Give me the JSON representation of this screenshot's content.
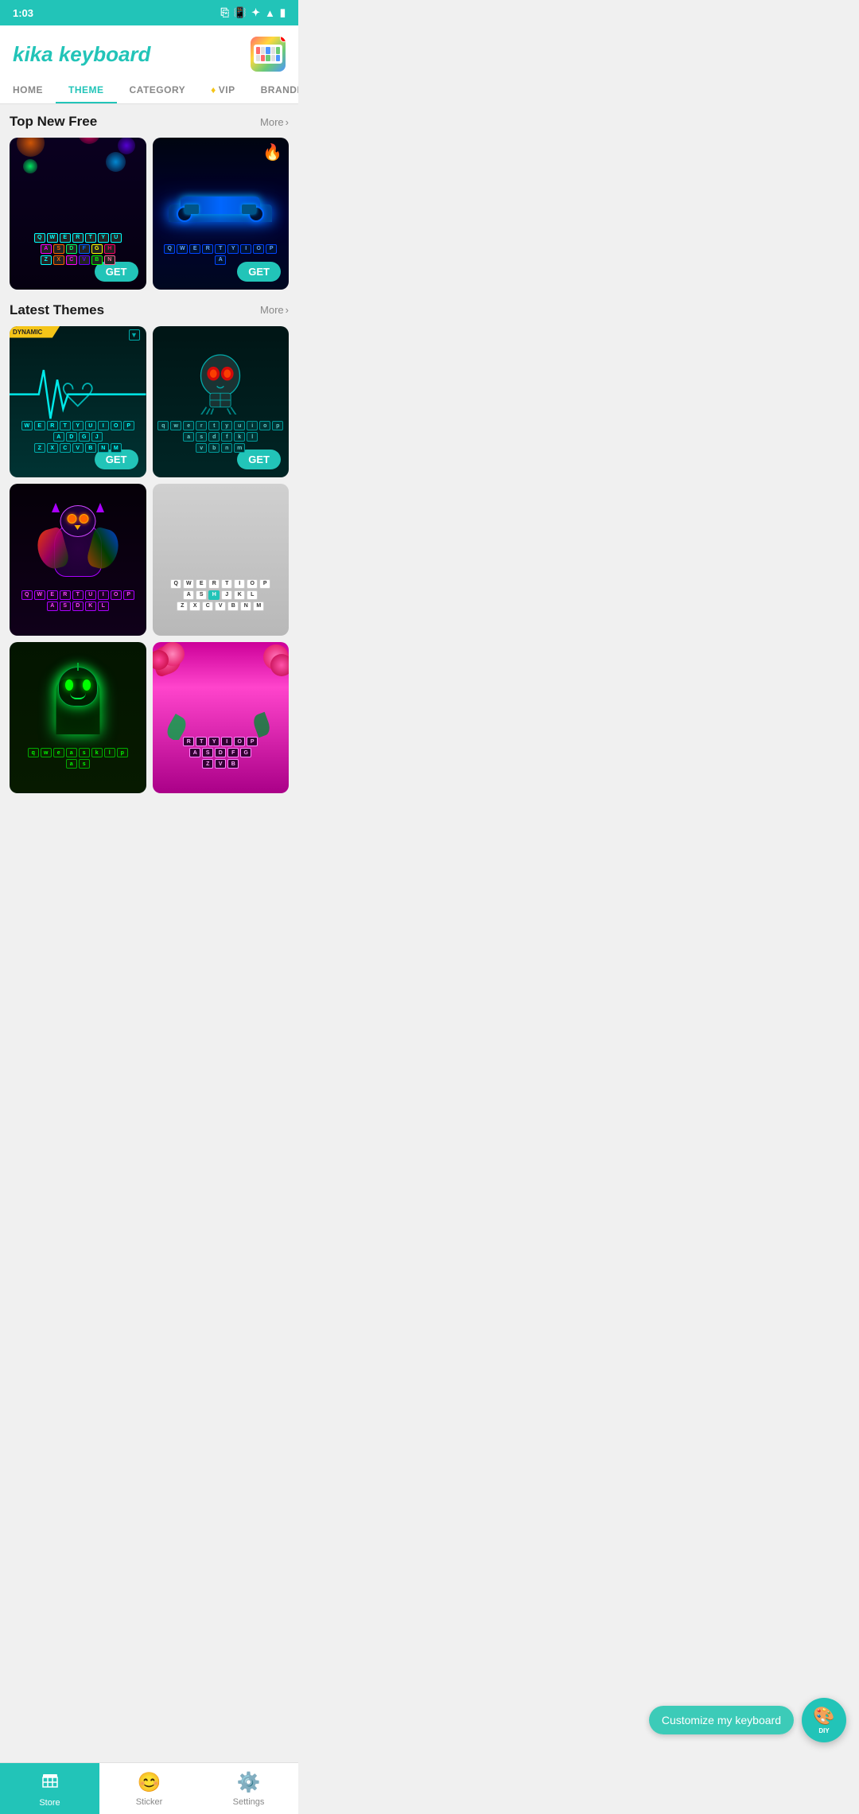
{
  "status": {
    "time": "1:03",
    "icons": [
      "cast",
      "vibrate",
      "star",
      "wifi",
      "battery"
    ]
  },
  "header": {
    "logo": "kika keyboard",
    "avatar_alt": "user avatar keyboard"
  },
  "nav": {
    "tabs": [
      {
        "id": "home",
        "label": "HOME",
        "active": false
      },
      {
        "id": "theme",
        "label": "THEME",
        "active": true
      },
      {
        "id": "category",
        "label": "CATEGORY",
        "active": false
      },
      {
        "id": "vip",
        "label": "VIP",
        "active": false,
        "has_icon": true
      },
      {
        "id": "branded",
        "label": "BRANDED",
        "active": false
      }
    ]
  },
  "sections": {
    "top_new_free": {
      "title": "Top New Free",
      "more_label": "More",
      "themes": [
        {
          "id": "neon_keys",
          "name": "Neon Keys",
          "style": "neon",
          "has_dynamic_badge": false,
          "has_fire_badge": false
        },
        {
          "id": "neon_car",
          "name": "Neon Car",
          "style": "car",
          "has_dynamic_badge": false,
          "has_fire_badge": true
        }
      ]
    },
    "latest_themes": {
      "title": "Latest Themes",
      "more_label": "More",
      "themes": [
        {
          "id": "heartbeat",
          "name": "Heartbeat",
          "style": "heart",
          "has_dynamic_badge": true
        },
        {
          "id": "skull",
          "name": "Skull",
          "style": "skull",
          "has_dynamic_badge": false
        },
        {
          "id": "owl",
          "name": "Owl",
          "style": "owl",
          "has_dynamic_badge": false
        },
        {
          "id": "white_clean",
          "name": "White Clean",
          "style": "white",
          "has_dynamic_badge": false
        },
        {
          "id": "ghost",
          "name": "Ghost",
          "style": "ghost",
          "has_dynamic_badge": false
        },
        {
          "id": "floral",
          "name": "Floral Pink",
          "style": "flower",
          "has_dynamic_badge": false
        }
      ]
    }
  },
  "floating": {
    "customize_label": "Customize my keyboard",
    "diy_label": "DIY"
  },
  "bottom_nav": {
    "items": [
      {
        "id": "store",
        "label": "Store",
        "icon": "🏪",
        "active": true
      },
      {
        "id": "sticker",
        "label": "Sticker",
        "icon": "😊",
        "active": false
      },
      {
        "id": "settings",
        "label": "Settings",
        "icon": "⚙️",
        "active": false
      }
    ]
  },
  "get_button_label": "GET",
  "dynamic_badge_label": "DYNAMIC"
}
